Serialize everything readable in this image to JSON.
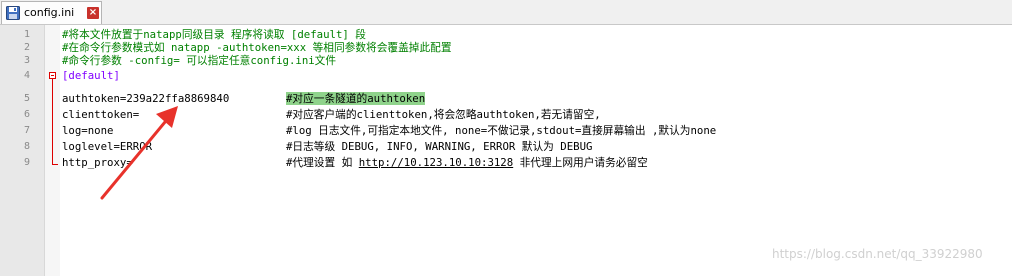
{
  "tab": {
    "filename": "config.ini",
    "close_glyph": "×",
    "save_icon": "floppy-disk-icon"
  },
  "line_numbers": [
    "1",
    "2",
    "3",
    "4",
    "5",
    "6",
    "7",
    "8",
    "9"
  ],
  "lines": {
    "l1": "#将本文件放置于natapp同级目录 程序将读取 [default] 段",
    "l2": "#在命令行参数模式如 natapp -authtoken=xxx 等相同参数将会覆盖掉此配置",
    "l3": "#命令行参数 -config= 可以指定任意config.ini文件",
    "l4": "[default]",
    "l5_key": "authtoken=239a22ffa8869840",
    "l5_comment_hl": "#对应一条隧道的authtoken",
    "l6_key": "clienttoken=",
    "l6_comment": "#对应客户端的clienttoken,将会忽略authtoken,若无请留空,",
    "l7_key": "log=none",
    "l7_comment": "#log 日志文件,可指定本地文件, none=不做记录,stdout=直接屏幕输出 ,默认为none",
    "l8_key": "loglevel=ERROR",
    "l8_comment": "#日志等级 DEBUG, INFO, WARNING, ERROR 默认为 DEBUG",
    "l9_key": "http_proxy=",
    "l9_comment_a": "#代理设置 如 ",
    "l9_link": "http://10.123.10.10:3128",
    "l9_comment_b": " 非代理上网用户请务必留空"
  },
  "colors": {
    "comment": "#008000",
    "section": "#8000ff",
    "highlight": "#8fd38b",
    "arrow": "#e8322b"
  },
  "watermark": "https://blog.csdn.net/qq_33922980"
}
